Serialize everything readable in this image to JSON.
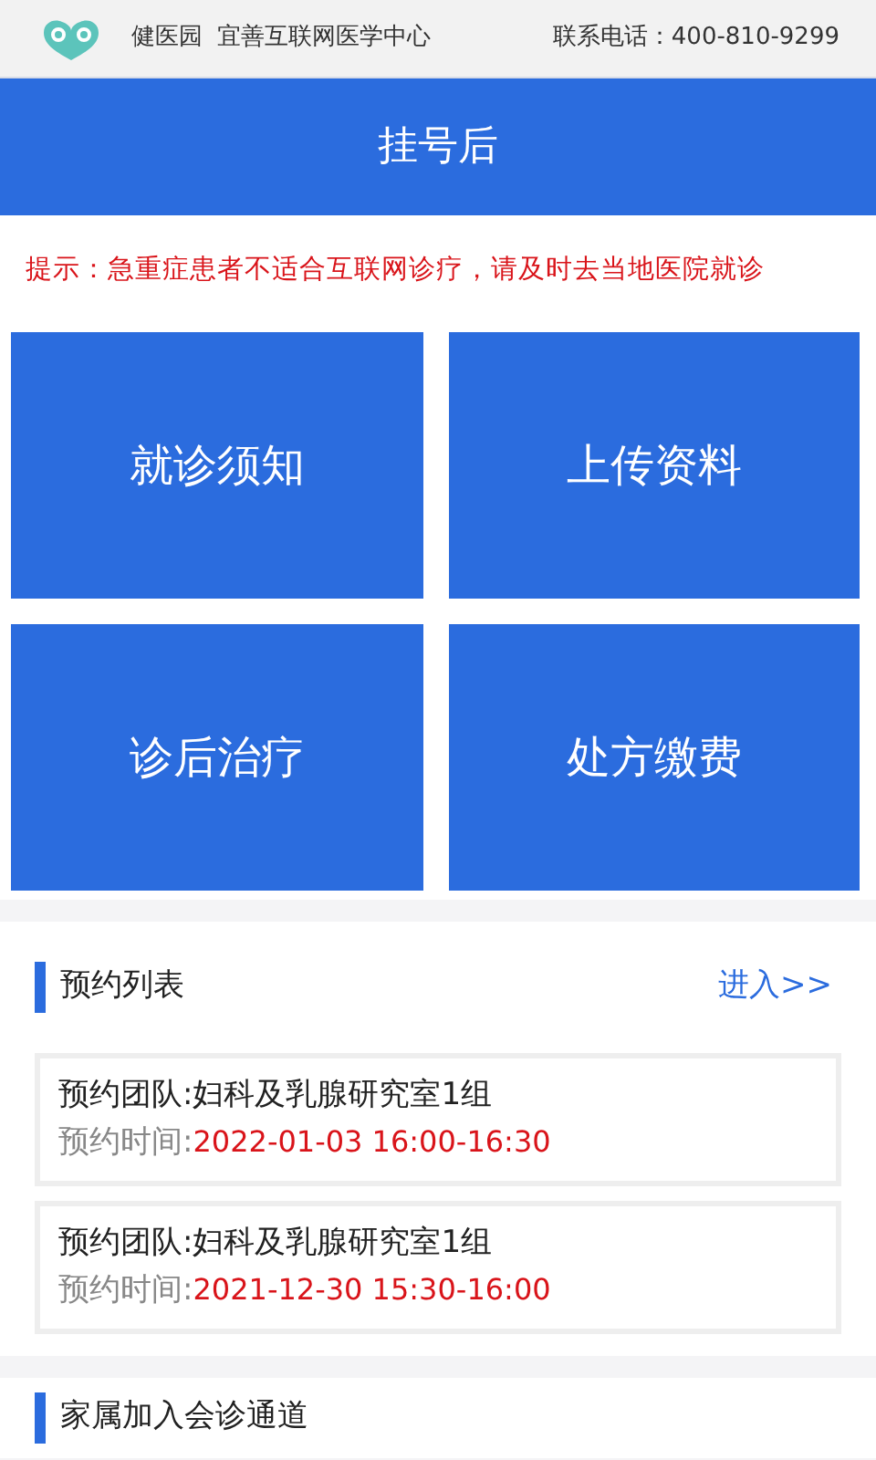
{
  "header": {
    "brand": "健医园",
    "org": "宜善互联网医学中心",
    "phone": "联系电话：400-810-9299"
  },
  "title": "挂号后",
  "notice": "提示：急重症患者不适合互联网诊疗，请及时去当地医院就诊",
  "tiles": [
    "就诊须知",
    "上传资料",
    "诊后治疗",
    "处方缴费"
  ],
  "appointments": {
    "title": "预约列表",
    "link": "进入>>",
    "items": [
      {
        "team": "预约团队:妇科及乳腺研究室1组",
        "time_label": "预约时间:",
        "time": "2022-01-03 16:00-16:30"
      },
      {
        "team": "预约团队:妇科及乳腺研究室1组",
        "time_label": "预约时间:",
        "time": "2021-12-30 15:30-16:00"
      }
    ]
  },
  "family": {
    "title": "家属加入会诊通道"
  }
}
